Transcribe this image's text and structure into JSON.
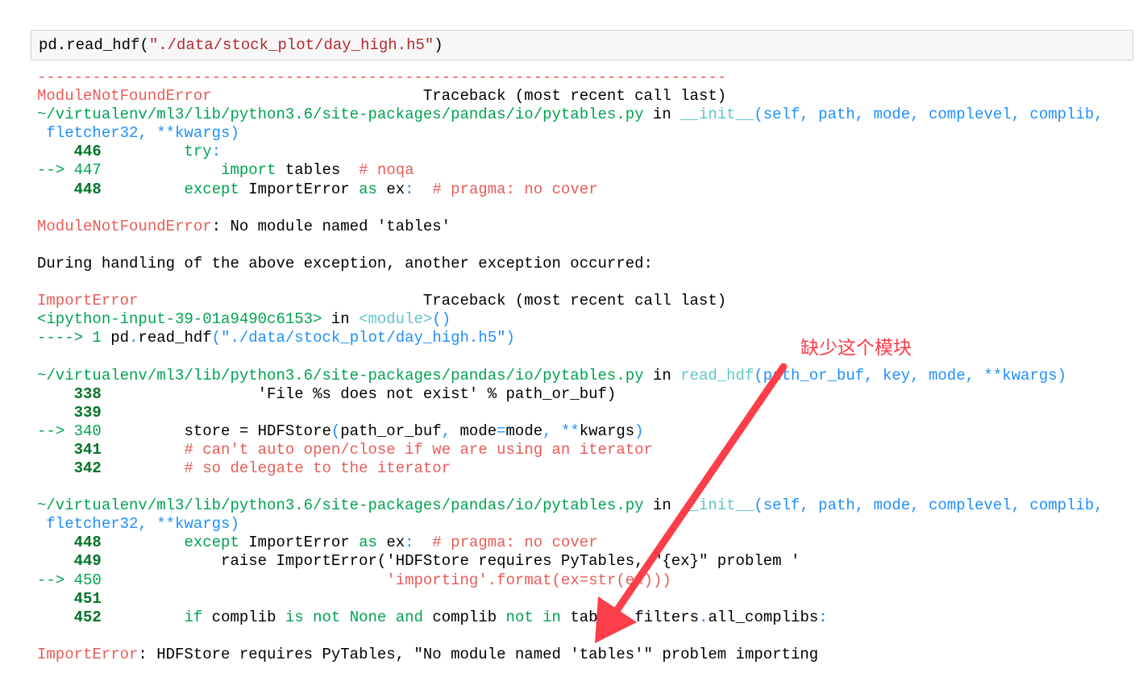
{
  "input_cell": {
    "code": [
      [
        "k",
        "pd.read_hdf("
      ],
      [
        "s",
        "\"./data/stock_plot/day_high.h5\""
      ],
      [
        "k",
        ")"
      ]
    ]
  },
  "output": {
    "lines": [
      [
        [
          "r",
          "---------------------------------------------------------------------------"
        ]
      ],
      [
        [
          "r",
          "ModuleNotFoundError"
        ],
        [
          "k",
          "                       Traceback (most recent call last)"
        ]
      ],
      [
        [
          "g",
          "~/virtualenv/ml3/lib/python3.6/site-packages/pandas/io/pytables.py"
        ],
        [
          "k",
          " in "
        ],
        [
          "c",
          "__init__"
        ],
        [
          "b",
          "(self, path, mode, complevel, complib,"
        ]
      ],
      [
        [
          "b",
          " fletcher32, **kwargs)"
        ]
      ],
      [
        [
          "G",
          "    446"
        ],
        [
          "k",
          "         "
        ],
        [
          "g",
          "try"
        ],
        [
          "b",
          ":"
        ]
      ],
      [
        [
          "g",
          "--> 447"
        ],
        [
          "k",
          "             "
        ],
        [
          "g",
          "import"
        ],
        [
          "k",
          " tables  "
        ],
        [
          "r",
          "# noqa"
        ]
      ],
      [
        [
          "G",
          "    448"
        ],
        [
          "k",
          "         "
        ],
        [
          "g",
          "except"
        ],
        [
          "k",
          " ImportError "
        ],
        [
          "g",
          "as"
        ],
        [
          "k",
          " ex"
        ],
        [
          "b",
          ":"
        ],
        [
          "k",
          "  "
        ],
        [
          "r",
          "# pragma: no cover"
        ]
      ],
      [],
      [
        [
          "r",
          "ModuleNotFoundError"
        ],
        [
          "k",
          ": No module named 'tables'"
        ]
      ],
      [],
      [
        [
          "k",
          "During handling of the above exception, another exception occurred:"
        ]
      ],
      [],
      [
        [
          "r",
          "ImportError"
        ],
        [
          "k",
          "                               Traceback (most recent call last)"
        ]
      ],
      [
        [
          "g",
          "<ipython-input-39-01a9490c6153>"
        ],
        [
          "k",
          " in "
        ],
        [
          "c",
          "<module>"
        ],
        [
          "b",
          "()"
        ]
      ],
      [
        [
          "g",
          "----> 1"
        ],
        [
          "k",
          " pd"
        ],
        [
          "b",
          "."
        ],
        [
          "k",
          "read_hdf"
        ],
        [
          "b",
          "(\"./data/stock_plot/day_high.h5\")"
        ]
      ],
      [],
      [
        [
          "g",
          "~/virtualenv/ml3/lib/python3.6/site-packages/pandas/io/pytables.py"
        ],
        [
          "k",
          " in "
        ],
        [
          "c",
          "read_hdf"
        ],
        [
          "b",
          "(path_or_buf, key, mode, **kwargs)"
        ]
      ],
      [
        [
          "G",
          "    338"
        ],
        [
          "k",
          "                 'File %s does not exist' % path_or_buf)"
        ]
      ],
      [
        [
          "G",
          "    339"
        ]
      ],
      [
        [
          "g",
          "--> 340"
        ],
        [
          "k",
          "         store = HDFStore"
        ],
        [
          "b",
          "("
        ],
        [
          "k",
          "path_or_buf"
        ],
        [
          "b",
          ","
        ],
        [
          "k",
          " mode"
        ],
        [
          "b",
          "="
        ],
        [
          "k",
          "mode"
        ],
        [
          "b",
          ", **"
        ],
        [
          "k",
          "kwargs"
        ],
        [
          "b",
          ")"
        ]
      ],
      [
        [
          "G",
          "    341"
        ],
        [
          "k",
          "         "
        ],
        [
          "r",
          "# can't auto open/close if we are using an iterator"
        ]
      ],
      [
        [
          "G",
          "    342"
        ],
        [
          "k",
          "         "
        ],
        [
          "r",
          "# so delegate to the iterator"
        ]
      ],
      [],
      [
        [
          "g",
          "~/virtualenv/ml3/lib/python3.6/site-packages/pandas/io/pytables.py"
        ],
        [
          "k",
          " in "
        ],
        [
          "c",
          "__init__"
        ],
        [
          "b",
          "(self, path, mode, complevel, complib,"
        ]
      ],
      [
        [
          "b",
          " fletcher32, **kwargs)"
        ]
      ],
      [
        [
          "G",
          "    448"
        ],
        [
          "k",
          "         "
        ],
        [
          "g",
          "except"
        ],
        [
          "k",
          " ImportError "
        ],
        [
          "g",
          "as"
        ],
        [
          "k",
          " ex"
        ],
        [
          "b",
          ":"
        ],
        [
          "k",
          "  "
        ],
        [
          "r",
          "# pragma: no cover"
        ]
      ],
      [
        [
          "G",
          "    449"
        ],
        [
          "k",
          "             raise ImportError('HDFStore requires PyTables, \"{ex}\" problem '"
        ]
      ],
      [
        [
          "g",
          "--> 450"
        ],
        [
          "k",
          "                               "
        ],
        [
          "r",
          "'importing'.format(ex=str(ex)))"
        ]
      ],
      [
        [
          "G",
          "    451"
        ]
      ],
      [
        [
          "G",
          "    452"
        ],
        [
          "k",
          "         "
        ],
        [
          "g",
          "if"
        ],
        [
          "k",
          " complib "
        ],
        [
          "g",
          "is not None and"
        ],
        [
          "k",
          " complib "
        ],
        [
          "g",
          "not in"
        ],
        [
          "k",
          " tables"
        ],
        [
          "b",
          "."
        ],
        [
          "k",
          "filters"
        ],
        [
          "b",
          "."
        ],
        [
          "k",
          "all_complibs"
        ],
        [
          "b",
          ":"
        ]
      ],
      [],
      [
        [
          "r",
          "ImportError"
        ],
        [
          "k",
          ": HDFStore requires PyTables, \"No module named 'tables'\" problem importing"
        ]
      ]
    ]
  },
  "annotation": {
    "text": "缺少这个模块",
    "color": "#fc3d4a"
  }
}
